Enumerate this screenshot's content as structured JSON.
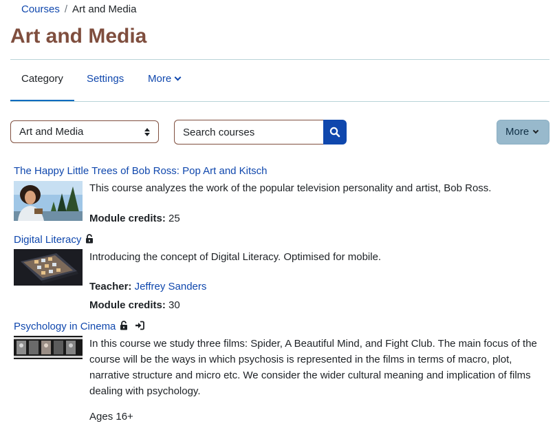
{
  "breadcrumb": {
    "root": "Courses",
    "separator": "/",
    "current": "Art and Media"
  },
  "page_title": "Art and Media",
  "nav": {
    "tabs": [
      {
        "label": "Category"
      },
      {
        "label": "Settings"
      },
      {
        "label": "More"
      }
    ]
  },
  "filters": {
    "category_selected": "Art and Media",
    "search_placeholder": "Search courses",
    "more_label": "More"
  },
  "courses": [
    {
      "title": "The Happy Little Trees of Bob Ross: Pop Art and Kitsch",
      "summary": "This course analyzes the work of the popular television personality and artist, Bob Ross.",
      "credits_label": "Module credits:",
      "credits": "25"
    },
    {
      "title": "Digital Literacy",
      "icons": [
        "unlock-icon"
      ],
      "summary": "Introducing the concept of Digital Literacy. Optimised for mobile.",
      "teacher_label": "Teacher:",
      "teacher": "Jeffrey Sanders",
      "credits_label": "Module credits:",
      "credits": "30"
    },
    {
      "title": "Psychology in Cinema",
      "icons": [
        "unlock-icon",
        "sign-in-icon"
      ],
      "summary": "In this course we study three films: Spider, A Beautiful Mind, and Fight Club. The main focus of the course will be the ways in which psychosis is represented in the films in terms of macro, plot, narrative structure and micro etc. We consider the wider cultural meaning and implication of films dealing with psychology.",
      "extra": "Ages 16+"
    }
  ],
  "colors": {
    "title": "#7f4e3e",
    "link": "#0f47ad",
    "primary": "#0f47ad",
    "more_button": "#98b9cc"
  }
}
